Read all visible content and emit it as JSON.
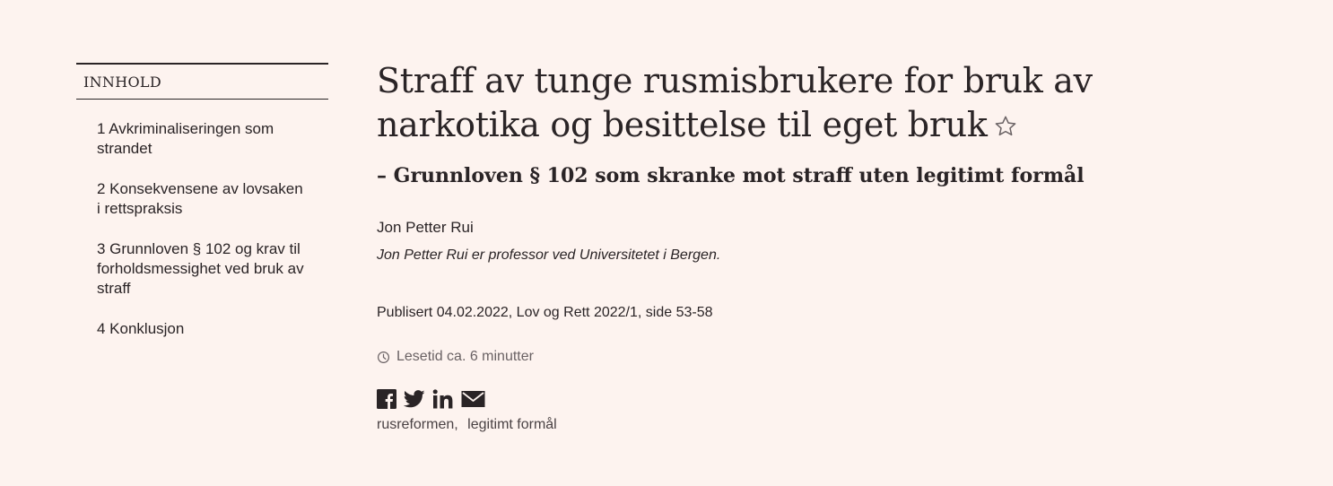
{
  "toc": {
    "header": "INNHOLD",
    "items": [
      {
        "label": "1 Avkriminaliseringen som strandet"
      },
      {
        "label": "2 Konsekvensene av lovsaken i rettspraksis"
      },
      {
        "label": "3 Grunnloven § 102 og krav til forholdsmessighet ved bruk av straff"
      },
      {
        "label": "4 Konklusjon"
      }
    ]
  },
  "article": {
    "title": "Straff av tunge rusmisbrukere for bruk av narkotika og besittelse til eget bruk",
    "subtitle": "– Grunnloven § 102 som skranke mot straff uten legitimt formål",
    "author": "Jon Petter Rui",
    "affiliation": "Jon Petter Rui er professor ved Universitetet i Bergen.",
    "published": "Publisert 04.02.2022, Lov og Rett 2022/1, side 53-58",
    "reading_time": "Lesetid ca. 6 minutter",
    "tags": [
      "rusreformen,",
      "legitimt formål"
    ]
  },
  "icons": {
    "favorite": "star-outline-icon",
    "clock": "clock-icon",
    "share": [
      "facebook-icon",
      "twitter-icon",
      "linkedin-icon",
      "email-icon"
    ]
  },
  "colors": {
    "background": "#fdf3ef",
    "text": "#2a2426",
    "muted": "#6a6264"
  }
}
